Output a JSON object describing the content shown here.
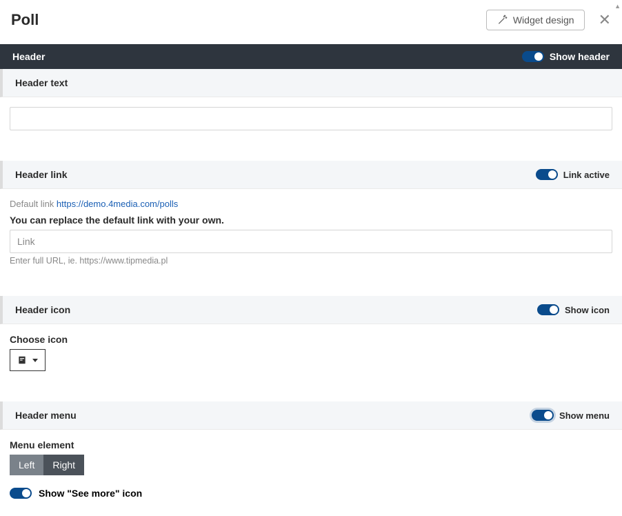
{
  "topbar": {
    "title": "Poll",
    "widget_design_label": "Widget design"
  },
  "sections": {
    "header": {
      "title": "Header",
      "show_header_label": "Show header"
    },
    "header_text": {
      "title": "Header text",
      "value": ""
    },
    "header_link": {
      "title": "Header link",
      "link_active_label": "Link active",
      "default_link_prefix": "Default link ",
      "default_link_url": "https://demo.4media.com/polls",
      "replace_label": "You can replace the default link with your own.",
      "link_placeholder": "Link",
      "link_hint": "Enter full URL, ie. https://www.tipmedia.pl"
    },
    "header_icon": {
      "title": "Header icon",
      "show_icon_label": "Show icon",
      "choose_icon_label": "Choose icon"
    },
    "header_menu": {
      "title": "Header menu",
      "show_menu_label": "Show menu",
      "menu_element_label": "Menu element",
      "left_label": "Left",
      "right_label": "Right",
      "see_more_label": "Show \"See more\" icon"
    }
  }
}
